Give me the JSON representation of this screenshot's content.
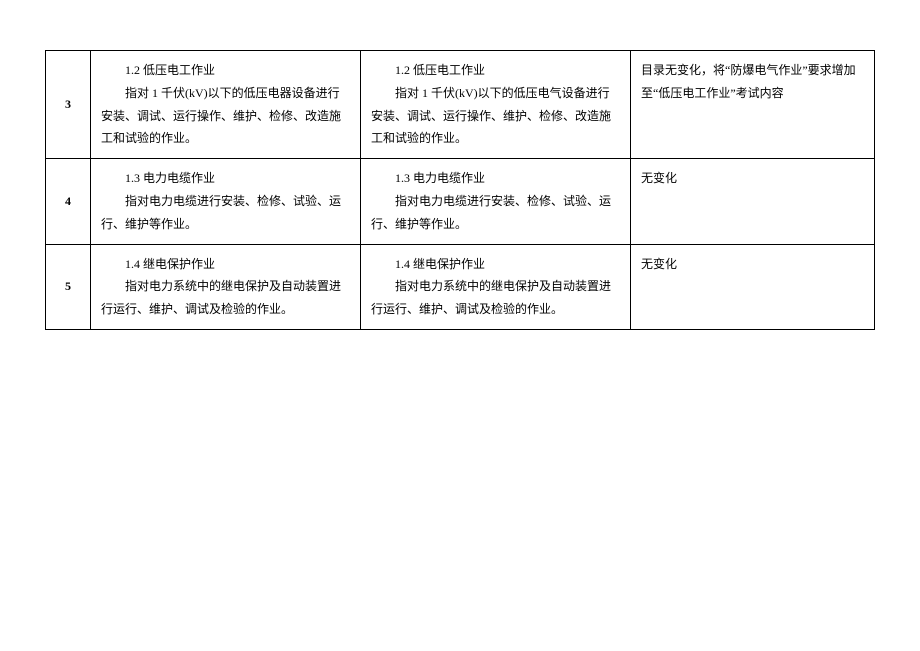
{
  "rows": [
    {
      "num": "3",
      "colA_head": "1.2 低压电工作业",
      "colA_body": "指对 1 千伏(kV)以下的低压电器设备进行安装、调试、运行操作、维护、检修、改造施工和试验的作业。",
      "colB_head": "1.2 低压电工作业",
      "colB_body": "指对 1 千伏(kV)以下的低压电气设备进行安装、调试、运行操作、维护、检修、改造施工和试验的作业。",
      "colC": "目录无变化，将“防爆电气作业”要求增加至“低压电工作业”考试内容"
    },
    {
      "num": "4",
      "colA_head": "1.3 电力电缆作业",
      "colA_body": "指对电力电缆进行安装、检修、试验、运行、维护等作业。",
      "colB_head": "1.3 电力电缆作业",
      "colB_body": "指对电力电缆进行安装、检修、试验、运行、维护等作业。",
      "colC": "无变化"
    },
    {
      "num": "5",
      "colA_head": "1.4 继电保护作业",
      "colA_body": "指对电力系统中的继电保护及自动装置进行运行、维护、调试及检验的作业。",
      "colB_head": "1.4 继电保护作业",
      "colB_body": "指对电力系统中的继电保护及自动装置进行运行、维护、调试及检验的作业。",
      "colC": "无变化"
    }
  ]
}
